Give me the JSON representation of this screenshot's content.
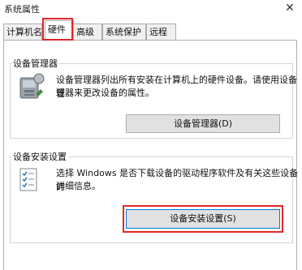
{
  "window": {
    "title": "系统属性",
    "close_glyph": "✕"
  },
  "tabs": [
    {
      "label": "计算机名",
      "active": false
    },
    {
      "label": "硬件",
      "active": true
    },
    {
      "label": "高级",
      "active": false
    },
    {
      "label": "系统保护",
      "active": false
    },
    {
      "label": "远程",
      "active": false
    }
  ],
  "device_manager": {
    "group_title": "设备管理器",
    "description_line1": "设备管理器列出所有安装在计算机上的硬件设备。请使用设备管",
    "description_line2": "理器来更改设备的属性。",
    "button_label": "设备管理器(D)",
    "icon": "device-manager-icon"
  },
  "device_installation": {
    "group_title": "设备安装设置",
    "description_line1": "选择 Windows 是否下载设备的驱动程序软件及有关这些设备的",
    "description_line2": "详细信息。",
    "button_label": "设备安装设置(S)",
    "icon": "checklist-icon"
  },
  "colors": {
    "highlight": "#e0262b",
    "focus": "#0078d7"
  }
}
